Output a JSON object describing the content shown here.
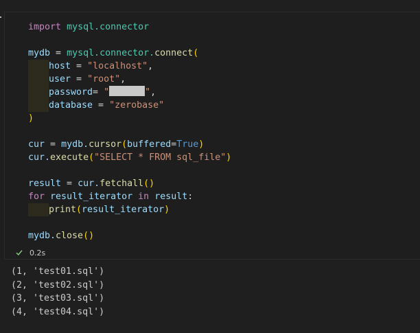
{
  "code": {
    "line1": {
      "kw": "import",
      "mod": "mysql.connector"
    },
    "line3": {
      "var": "mydb",
      "eq": " = ",
      "mod": "mysql.connector.",
      "fn": "connect",
      "open": "("
    },
    "line4": {
      "key": "host",
      "eq": " = ",
      "val": "\"localhost\"",
      "comma": ","
    },
    "line5": {
      "key": "user",
      "eq": " = ",
      "val": "\"root\"",
      "comma": ","
    },
    "line6": {
      "key": "password",
      "eq": "= ",
      "q1": "\"",
      "q2": "\"",
      "comma": ","
    },
    "line7": {
      "key": "database",
      "eq": " = ",
      "val": "\"zerobase\""
    },
    "line8": {
      "close": ")"
    },
    "line10": {
      "var": "cur",
      "eq": " = ",
      "obj": "mydb.",
      "fn": "cursor",
      "open": "(",
      "arg": "buffered",
      "argeq": "=",
      "const": "True",
      "close": ")"
    },
    "line11": {
      "obj": "cur.",
      "fn": "execute",
      "open": "(",
      "val": "\"SELECT * FROM sql_file\"",
      "close": ")"
    },
    "line13": {
      "var": "result",
      "eq": " = ",
      "obj": "cur.",
      "fn": "fetchall",
      "parens": "()"
    },
    "line14": {
      "kw": "for",
      "var": "result_iterator",
      "kw2": "in",
      "var2": "result",
      "colon": ":"
    },
    "line15": {
      "fn": "print",
      "open": "(",
      "arg": "result_iterator",
      "close": ")"
    },
    "line17": {
      "obj": "mydb.",
      "fn": "close",
      "parens": "()"
    }
  },
  "status": {
    "icon": "check-icon",
    "time": "0.2s",
    "color": "#89d185"
  },
  "output": [
    "(1, 'test01.sql')",
    "(2, 'test02.sql')",
    "(3, 'test03.sql')",
    "(4, 'test04.sql')"
  ]
}
